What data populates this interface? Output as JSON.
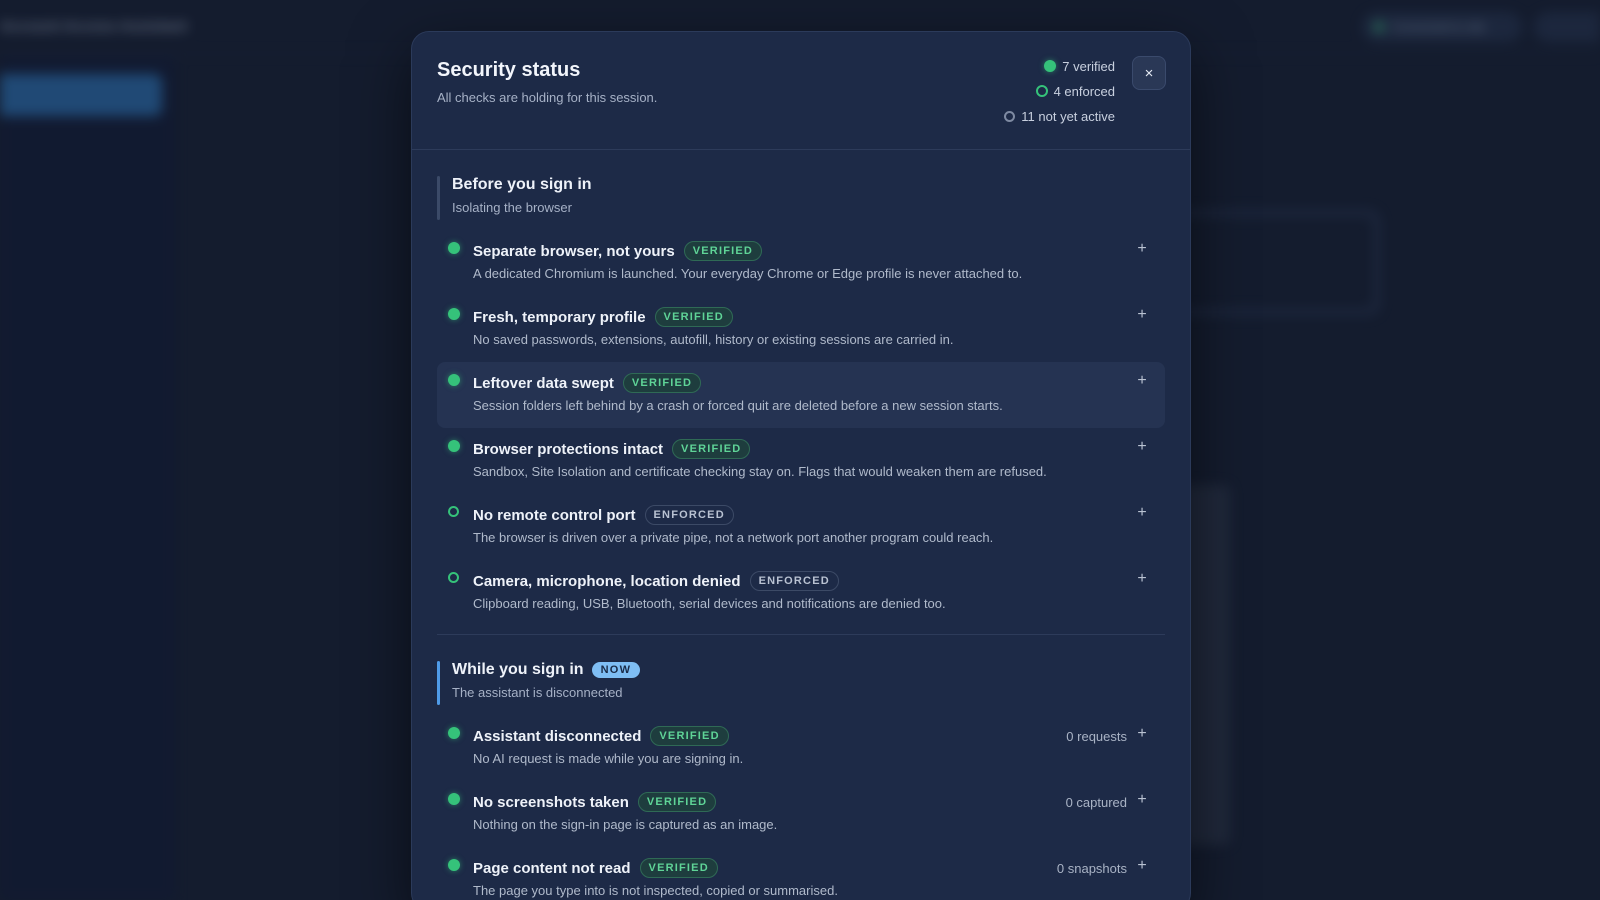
{
  "background": {
    "app_title": "Account Access Assistant",
    "status_pill": "Connected to site"
  },
  "modal": {
    "title": "Security status",
    "subtitle": "All checks are holding for this session.",
    "legend": {
      "verified": "7 verified",
      "enforced": "4 enforced",
      "inactive": "11 not yet active"
    },
    "close_label": "×"
  },
  "sections": [
    {
      "title": "Before you sign in",
      "subtitle": "Isolating the browser",
      "checks": [
        {
          "title": "Separate browser, not yours",
          "badge": "VERIFIED",
          "desc": "A dedicated Chromium is launched. Your everyday Chrome or Edge profile is never attached to.",
          "expand": "+"
        },
        {
          "title": "Fresh, temporary profile",
          "badge": "VERIFIED",
          "desc": "No saved passwords, extensions, autofill, history or existing sessions are carried in.",
          "expand": "+"
        },
        {
          "title": "Leftover data swept",
          "badge": "VERIFIED",
          "desc": "Session folders left behind by a crash or forced quit are deleted before a new session starts.",
          "expand": "+"
        },
        {
          "title": "Browser protections intact",
          "badge": "VERIFIED",
          "desc": "Sandbox, Site Isolation and certificate checking stay on. Flags that would weaken them are refused.",
          "expand": "+"
        },
        {
          "title": "No remote control port",
          "badge": "ENFORCED",
          "desc": "The browser is driven over a private pipe, not a network port another program could reach.",
          "expand": "+"
        },
        {
          "title": "Camera, microphone, location denied",
          "badge": "ENFORCED",
          "desc": "Clipboard reading, USB, Bluetooth, serial devices and notifications are denied too.",
          "expand": "+"
        }
      ]
    },
    {
      "title": "While you sign in",
      "badge": "NOW",
      "subtitle": "The assistant is disconnected",
      "checks": [
        {
          "title": "Assistant disconnected",
          "badge": "VERIFIED",
          "desc": "No AI request is made while you are signing in.",
          "count": "0 requests",
          "expand": "+"
        },
        {
          "title": "No screenshots taken",
          "badge": "VERIFIED",
          "desc": "Nothing on the sign-in page is captured as an image.",
          "count": "0 captured",
          "expand": "+"
        },
        {
          "title": "Page content not read",
          "badge": "VERIFIED",
          "desc": "The page you type into is not inspected, copied or summarised.",
          "count": "0 snapshots",
          "expand": "+"
        }
      ]
    }
  ],
  "colors": {
    "verified": "#35c27a",
    "accent_now": "#4f9be8",
    "modal_bg": "#1d2a47"
  }
}
